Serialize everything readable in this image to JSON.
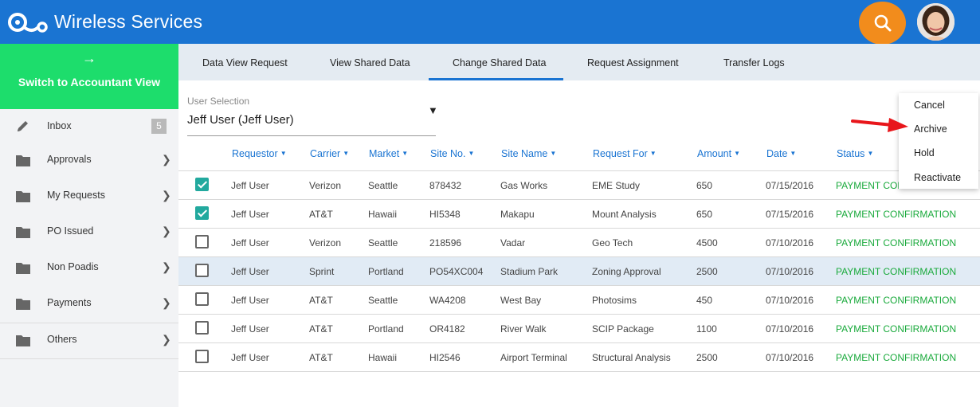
{
  "app": {
    "title": "Wireless Services"
  },
  "sidebar": {
    "switch_arrow": "→",
    "switch_label": "Switch to Accountant View",
    "inbox": {
      "label": "Inbox",
      "count": "5"
    },
    "items": [
      {
        "label": "Approvals"
      },
      {
        "label": "My Requests"
      },
      {
        "label": "PO Issued"
      },
      {
        "label": "Non Poadis"
      },
      {
        "label": "Payments"
      },
      {
        "label": "Others"
      }
    ]
  },
  "tabs": [
    {
      "label": "Data View Request"
    },
    {
      "label": "View Shared Data"
    },
    {
      "label": "Change Shared Data",
      "active": true
    },
    {
      "label": "Request Assignment"
    },
    {
      "label": "Transfer Logs"
    }
  ],
  "user_selection": {
    "label": "User Selection",
    "value": "Jeff User (Jeff User)",
    "arrow": "▼"
  },
  "table": {
    "columns": [
      "Requestor",
      "Carrier",
      "Market",
      "Site No.",
      "Site Name",
      "Request For",
      "Amount",
      "Date",
      "Status"
    ],
    "rows": [
      {
        "checked": true,
        "cells": [
          "Jeff User",
          "Verizon",
          "Seattle",
          "878432",
          "Gas Works",
          "EME Study",
          "650",
          "07/15/2016",
          "PAYMENT CONFIRMATION"
        ]
      },
      {
        "checked": true,
        "cells": [
          "Jeff User",
          "AT&T",
          "Hawaii",
          "HI5348",
          "Makapu",
          "Mount Analysis",
          "650",
          "07/15/2016",
          "PAYMENT CONFIRMATION"
        ]
      },
      {
        "checked": false,
        "cells": [
          "Jeff User",
          "Verizon",
          "Seattle",
          "218596",
          "Vadar",
          "Geo Tech",
          "4500",
          "07/10/2016",
          "PAYMENT CONFIRMATION"
        ]
      },
      {
        "checked": false,
        "highlight": true,
        "cells": [
          "Jeff User",
          "Sprint",
          "Portland",
          "PO54XC004",
          "Stadium Park",
          "Zoning Approval",
          "2500",
          "07/10/2016",
          "PAYMENT CONFIRMATION"
        ]
      },
      {
        "checked": false,
        "cells": [
          "Jeff User",
          "AT&T",
          "Seattle",
          "WA4208",
          "West Bay",
          "Photosims",
          "450",
          "07/10/2016",
          "PAYMENT CONFIRMATION"
        ]
      },
      {
        "checked": false,
        "cells": [
          "Jeff User",
          "AT&T",
          "Portland",
          "OR4182",
          "River Walk",
          "SCIP Package",
          "1100",
          "07/10/2016",
          "PAYMENT CONFIRMATION"
        ]
      },
      {
        "checked": false,
        "cells": [
          "Jeff User",
          "AT&T",
          "Hawaii",
          "HI2546",
          "Airport Terminal",
          "Structural Analysis",
          "2500",
          "07/10/2016",
          "PAYMENT CONFIRMATION"
        ]
      }
    ]
  },
  "action_menu": {
    "items": [
      {
        "label": "Cancel"
      },
      {
        "label": "Archive"
      },
      {
        "label": "Hold"
      },
      {
        "label": "Reactivate"
      }
    ]
  },
  "colors": {
    "header_bg": "#1a74d2",
    "switch_bg": "#1ddd6c",
    "search_bg": "#f28c1c",
    "status_text": "#1aaa3c",
    "checkbox_checked": "#22a99e",
    "pointer": "#e8161b"
  },
  "icons": {
    "logo": "logo-icon",
    "search": "search-icon",
    "inbox": "pencil-icon",
    "folder": "folder-icon",
    "chevron": "chevron-right-icon",
    "pointer": "red-arrow-pointer-icon"
  }
}
